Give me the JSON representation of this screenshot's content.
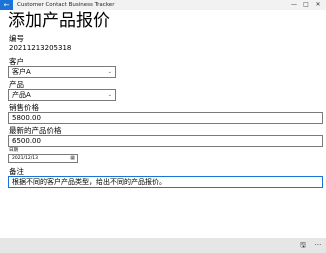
{
  "window": {
    "back_glyph": "←",
    "title": "Customer Contact Business Tracker",
    "minimize_glyph": "—",
    "maximize_glyph": "□",
    "close_glyph": "✕"
  },
  "page": {
    "title": "添加产品报价"
  },
  "form": {
    "number": {
      "label": "编号",
      "value": "20211213205318"
    },
    "customer": {
      "label": "客户",
      "value": "客户A"
    },
    "product": {
      "label": "产品",
      "value": "产品A"
    },
    "sale_price": {
      "label": "销售价格",
      "value": "5800.00"
    },
    "latest_price": {
      "label": "最新的产品价格",
      "value": "6500.00"
    },
    "date": {
      "label": "日期",
      "value": "2021/12/13"
    },
    "remark": {
      "label": "备注",
      "value": "根据不同的客户产品类型，给出不同的产品报价。"
    }
  },
  "icons": {
    "chevron": "⌄",
    "calendar": "▦",
    "save": "🖫",
    "more": "···"
  }
}
